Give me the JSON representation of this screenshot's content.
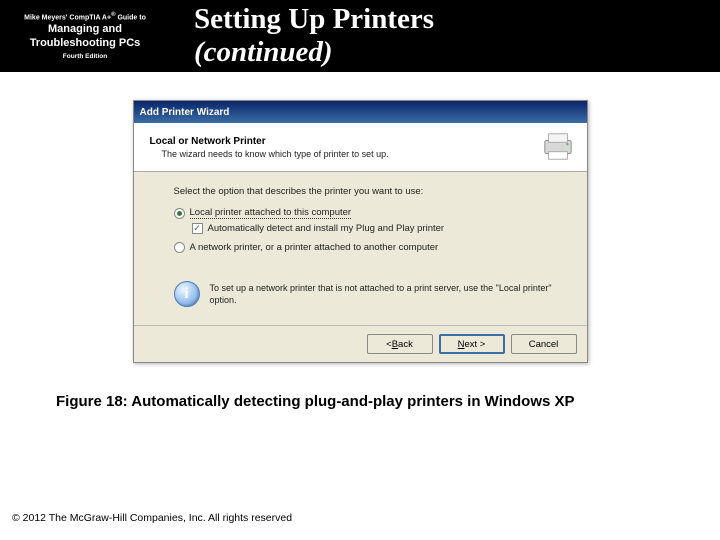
{
  "book": {
    "series_prefix": "Mike Meyers' CompTIA A+",
    "series_suffix": "Guide to",
    "reg": "®",
    "title": "Managing and Troubleshooting PCs",
    "edition": "Fourth Edition"
  },
  "slide": {
    "title_main": "Setting Up Printers",
    "title_cont": "(continued)"
  },
  "wizard": {
    "titlebar": "Add Printer Wizard",
    "header_title": "Local or Network Printer",
    "header_sub": "The wizard needs to know which type of printer to set up.",
    "prompt": "Select the option that describes the printer you want to use:",
    "radio1": "Local printer attached to this computer",
    "checkbox": "Automatically detect and install my Plug and Play printer",
    "radio2": "A network printer, or a printer attached to another computer",
    "info": "To set up a network printer that is not attached to a print server, use the \"Local printer\" option.",
    "btn_back_u": "B",
    "btn_back_rest": "ack",
    "btn_back_prefix": "< ",
    "btn_next_u": "N",
    "btn_next_rest": "ext >",
    "btn_cancel": "Cancel"
  },
  "caption": "Figure 18: Automatically detecting plug-and-play printers in Windows XP",
  "copyright": "© 2012 The McGraw-Hill Companies, Inc. All rights reserved"
}
